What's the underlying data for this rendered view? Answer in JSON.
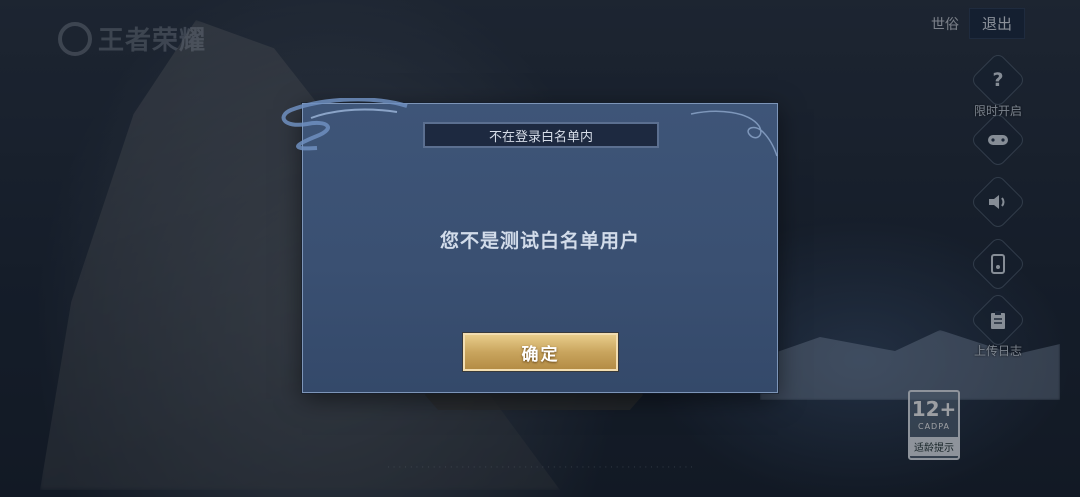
{
  "background": {
    "logo_text": "王者荣耀"
  },
  "header": {
    "username": "世俗",
    "logout_label": "退出"
  },
  "side_menu": {
    "items": [
      {
        "icon": "question-icon",
        "glyph": "?",
        "label": "限时开启"
      },
      {
        "icon": "gamepad-icon",
        "glyph": "🎮",
        "label": ""
      },
      {
        "icon": "speaker-icon",
        "glyph": "🔊",
        "label": ""
      },
      {
        "icon": "phone-icon",
        "glyph": "▯",
        "label": ""
      },
      {
        "icon": "clipboard-icon",
        "glyph": "📋",
        "label": "上传日志"
      }
    ]
  },
  "age_rating": {
    "age": "12+",
    "org": "CADPA",
    "tip": "适龄提示"
  },
  "dialog": {
    "title": "不在登录白名单内",
    "message": "您不是测试白名单用户",
    "confirm_label": "确定"
  },
  "colors": {
    "dialog_bg": "#3e5578",
    "dialog_border": "#7d95b8",
    "confirm_gold": "#c9a55e"
  }
}
